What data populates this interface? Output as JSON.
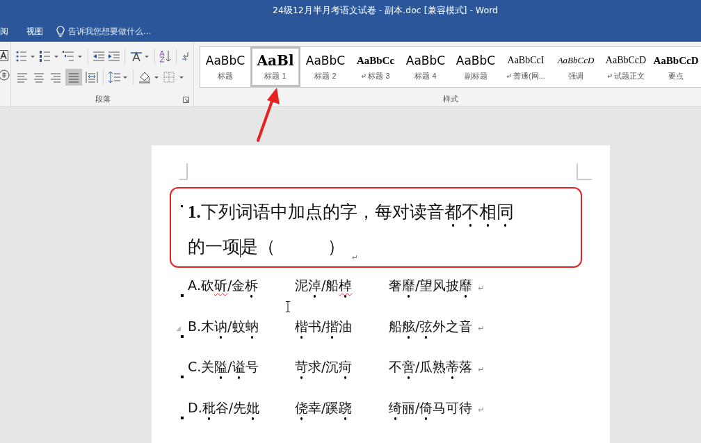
{
  "window": {
    "title": "24级12月半月考语文试卷 - 副本.doc [兼容模式] - Word"
  },
  "tabs": [
    {
      "label": "阅",
      "selected": false
    },
    {
      "label": "视图",
      "selected": false
    }
  ],
  "tell_me": {
    "placeholder": "告诉我您想要做什么..."
  },
  "ribbon": {
    "paragraph_group": {
      "label": "段落",
      "justify_selected": true
    },
    "styles_group": {
      "label": "样式",
      "styles": [
        {
          "preview": "AaBbC",
          "label": "标题",
          "linked": false,
          "kind": "sans",
          "selected": false
        },
        {
          "preview": "AaBl",
          "label": "标题 1",
          "linked": false,
          "kind": "heavy",
          "selected": true
        },
        {
          "preview": "AaBbC",
          "label": "标题 2",
          "linked": false,
          "kind": "sans",
          "selected": false
        },
        {
          "preview": "AaBbCc",
          "label": "标题 3",
          "linked": true,
          "kind": "bold",
          "selected": false
        },
        {
          "preview": "AaBbC",
          "label": "标题 4",
          "linked": false,
          "kind": "sans",
          "selected": false
        },
        {
          "preview": "AaBbC",
          "label": "副标题",
          "linked": false,
          "kind": "sans",
          "selected": false
        },
        {
          "preview": "AaBbCcI",
          "label": "普通(网...",
          "linked": true,
          "kind": "serif",
          "selected": false
        },
        {
          "preview": "AaBbCcD",
          "label": "强调",
          "linked": false,
          "kind": "italic",
          "selected": false
        },
        {
          "preview": "AaBbCcD",
          "label": "试题正文",
          "linked": true,
          "kind": "serif",
          "selected": false
        },
        {
          "preview": "AaBbCcD",
          "label": "要点",
          "linked": false,
          "kind": "bold",
          "selected": false
        }
      ]
    }
  },
  "document": {
    "question": {
      "number": "1.",
      "lines": [
        {
          "runs": [
            {
              "text": "下列词语中加点的字，每对读音",
              "dotted": false
            },
            {
              "text": "都不相同",
              "dotted": true
            }
          ]
        },
        {
          "runs": [
            {
              "text": "的一项",
              "dotted": false
            },
            {
              "text": "是（　　　）",
              "dotted": false
            }
          ]
        }
      ],
      "end_mark": "↵",
      "highlighted": true
    },
    "options": [
      {
        "segments": [
          [
            {
              "text": "A.砍",
              "dotted": false,
              "misspelled": false
            },
            {
              "text": "斫",
              "dotted": false,
              "misspelled": true
            },
            {
              "text": "/金",
              "dotted": false,
              "misspelled": false
            },
            {
              "text": "柝",
              "dotted": true,
              "misspelled": false
            }
          ],
          [
            {
              "text": "泥",
              "dotted": false,
              "misspelled": false
            },
            {
              "text": "淖",
              "dotted": true,
              "misspelled": false
            },
            {
              "text": "/船",
              "dotted": false,
              "misspelled": false
            },
            {
              "text": "棹",
              "dotted": true,
              "misspelled": true
            }
          ],
          [
            {
              "text": "奢",
              "dotted": false,
              "misspelled": false
            },
            {
              "text": "靡",
              "dotted": true,
              "misspelled": false
            },
            {
              "text": "/望风披",
              "dotted": false,
              "misspelled": false
            },
            {
              "text": "靡",
              "dotted": true,
              "misspelled": false
            }
          ]
        ],
        "end_mark": "↵"
      },
      {
        "segments": [
          [
            {
              "text": "B.木",
              "dotted": false,
              "misspelled": false
            },
            {
              "text": "讷",
              "dotted": true,
              "misspelled": false
            },
            {
              "text": "/蚊",
              "dotted": false,
              "misspelled": false
            },
            {
              "text": "蚋",
              "dotted": true,
              "misspelled": false
            }
          ],
          [
            {
              "text": "楷",
              "dotted": true,
              "misspelled": false
            },
            {
              "text": "书/",
              "dotted": false,
              "misspelled": false
            },
            {
              "text": "揩",
              "dotted": true,
              "misspelled": false
            },
            {
              "text": "油",
              "dotted": false,
              "misspelled": false
            }
          ],
          [
            {
              "text": "船",
              "dotted": false,
              "misspelled": false
            },
            {
              "text": "舷",
              "dotted": true,
              "misspelled": false
            },
            {
              "text": "/",
              "dotted": false,
              "misspelled": false
            },
            {
              "text": "弦",
              "dotted": true,
              "misspelled": false
            },
            {
              "text": "外之音",
              "dotted": false,
              "misspelled": false
            }
          ]
        ],
        "end_mark": "↵"
      },
      {
        "segments": [
          [
            {
              "text": "C.关",
              "dotted": false,
              "misspelled": false
            },
            {
              "text": "隘",
              "dotted": true,
              "misspelled": false
            },
            {
              "text": "/",
              "dotted": false,
              "misspelled": false
            },
            {
              "text": "谥",
              "dotted": true,
              "misspelled": false
            },
            {
              "text": "号",
              "dotted": false,
              "misspelled": false
            }
          ],
          [
            {
              "text": "苛",
              "dotted": true,
              "misspelled": false
            },
            {
              "text": "求/沉",
              "dotted": false,
              "misspelled": false
            },
            {
              "text": "疴",
              "dotted": true,
              "misspelled": false
            }
          ],
          [
            {
              "text": "不",
              "dotted": false,
              "misspelled": false
            },
            {
              "text": "啻",
              "dotted": true,
              "misspelled": false
            },
            {
              "text": "/瓜熟",
              "dotted": false,
              "misspelled": false
            },
            {
              "text": "蒂",
              "dotted": true,
              "misspelled": false
            },
            {
              "text": "落",
              "dotted": false,
              "misspelled": false
            }
          ]
        ],
        "end_mark": "↵"
      },
      {
        "segments": [
          [
            {
              "text": "D.",
              "dotted": false,
              "misspelled": false
            },
            {
              "text": "秕",
              "dotted": true,
              "misspelled": false
            },
            {
              "text": "谷/先",
              "dotted": false,
              "misspelled": false
            },
            {
              "text": "妣",
              "dotted": true,
              "misspelled": false
            }
          ],
          [
            {
              "text": "侥",
              "dotted": true,
              "misspelled": false
            },
            {
              "text": "幸/蹊",
              "dotted": false,
              "misspelled": false
            },
            {
              "text": "跷",
              "dotted": true,
              "misspelled": false
            }
          ],
          [
            {
              "text": "绮",
              "dotted": true,
              "misspelled": false
            },
            {
              "text": "丽/",
              "dotted": false,
              "misspelled": false
            },
            {
              "text": "倚",
              "dotted": true,
              "misspelled": false
            },
            {
              "text": "马可待",
              "dotted": false,
              "misspelled": false
            }
          ]
        ],
        "end_mark": "↵"
      }
    ]
  }
}
